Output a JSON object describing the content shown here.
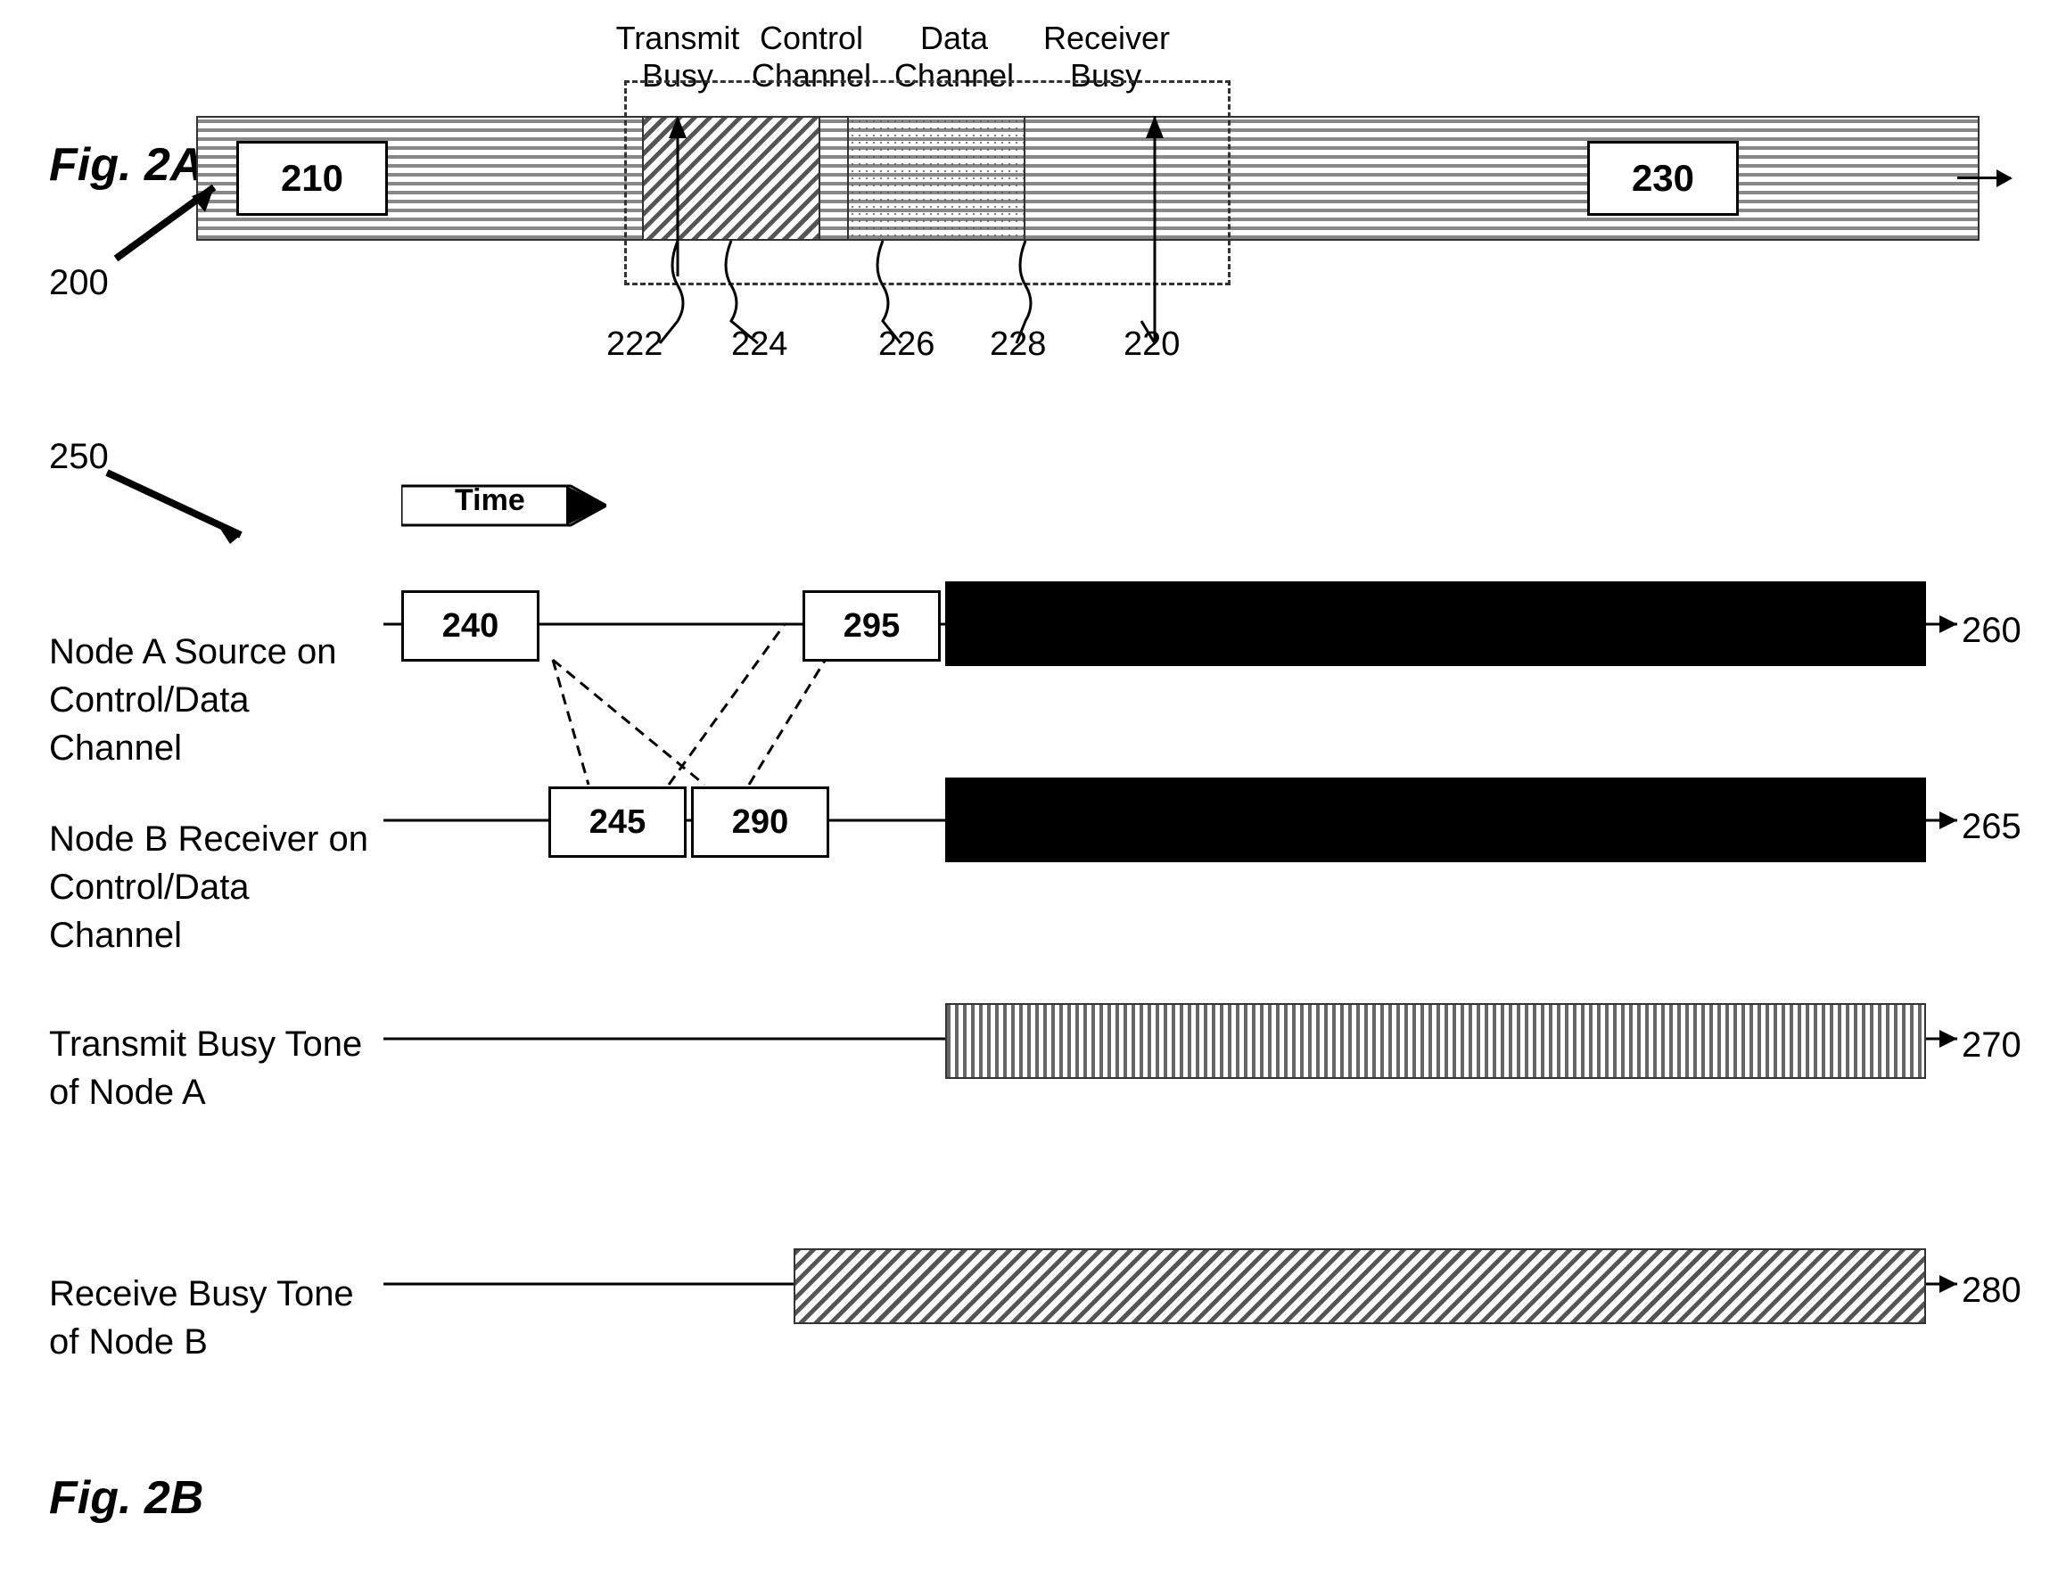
{
  "fig2a": {
    "label": "Fig. 2A",
    "ref_200": "200",
    "ref_210": "210",
    "ref_220": "220",
    "ref_222": "222",
    "ref_224": "224",
    "ref_226": "226",
    "ref_228": "228",
    "ref_230": "230",
    "label_transmit_busy": "Transmit\nBusy",
    "label_control_channel": "Control\nChannel",
    "label_data_channel": "Data\nChannel",
    "label_receiver_busy": "Receiver\nBusy"
  },
  "fig2b": {
    "label": "Fig. 2B",
    "ref_250": "250",
    "ref_260": "260",
    "ref_265": "265",
    "ref_270": "270",
    "ref_280": "280",
    "ref_240": "240",
    "ref_245": "245",
    "ref_290": "290",
    "ref_295": "295",
    "label_time": "Time",
    "label_node_a": "Node A Source on\nControl/Data Channel",
    "label_node_b": "Node B Receiver on\nControl/Data Channel",
    "label_transmit_busy_tone": "Transmit Busy Tone\nof Node A",
    "label_receive_busy_tone": "Receive Busy Tone\nof Node B"
  }
}
